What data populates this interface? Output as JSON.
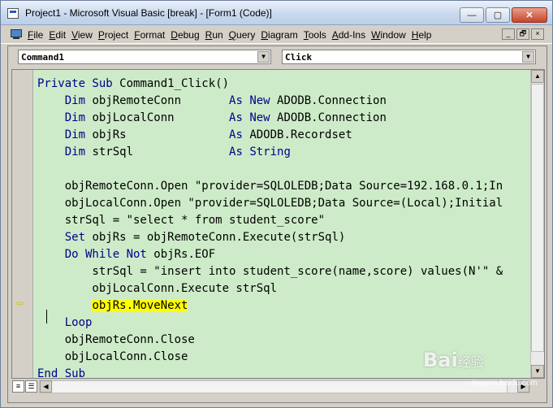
{
  "window": {
    "title": "Project1 - Microsoft Visual Basic [break] - [Form1 (Code)]",
    "controls": {
      "minimize": "—",
      "maximize": "▢",
      "close": "✕"
    }
  },
  "menubar": {
    "items": [
      "File",
      "Edit",
      "View",
      "Project",
      "Format",
      "Debug",
      "Run",
      "Query",
      "Diagram",
      "Tools",
      "Add-Ins",
      "Window",
      "Help"
    ],
    "mdi_controls": {
      "minimize": "_",
      "restore": "🗗",
      "close": "×"
    }
  },
  "code_window": {
    "object_combo": "Command1",
    "procedure_combo": "Click",
    "lines": [
      [
        {
          "t": "Private Sub ",
          "c": "kw"
        },
        {
          "t": "Command1_Click()"
        }
      ],
      [
        {
          "t": "    "
        },
        {
          "t": "Dim",
          "c": "kw"
        },
        {
          "t": " objRemoteConn       "
        },
        {
          "t": "As New",
          "c": "kw"
        },
        {
          "t": " ADODB.Connection"
        }
      ],
      [
        {
          "t": "    "
        },
        {
          "t": "Dim",
          "c": "kw"
        },
        {
          "t": " objLocalConn        "
        },
        {
          "t": "As New",
          "c": "kw"
        },
        {
          "t": " ADODB.Connection"
        }
      ],
      [
        {
          "t": "    "
        },
        {
          "t": "Dim",
          "c": "kw"
        },
        {
          "t": " objRs               "
        },
        {
          "t": "As",
          "c": "kw"
        },
        {
          "t": " ADODB.Recordset"
        }
      ],
      [
        {
          "t": "    "
        },
        {
          "t": "Dim",
          "c": "kw"
        },
        {
          "t": " strSql              "
        },
        {
          "t": "As String",
          "c": "kw"
        }
      ],
      [
        {
          "t": ""
        }
      ],
      [
        {
          "t": "    objRemoteConn.Open \"provider=SQLOLEDB;Data Source=192.168.0.1;In"
        }
      ],
      [
        {
          "t": "    objLocalConn.Open \"provider=SQLOLEDB;Data Source=(Local);Initial"
        }
      ],
      [
        {
          "t": "    strSql = \"select * from student_score\""
        }
      ],
      [
        {
          "t": "    "
        },
        {
          "t": "Set",
          "c": "kw"
        },
        {
          "t": " objRs = objRemoteConn.Execute(strSql)"
        }
      ],
      [
        {
          "t": "    "
        },
        {
          "t": "Do While Not",
          "c": "kw"
        },
        {
          "t": " objRs.EOF"
        }
      ],
      [
        {
          "t": "        strSql = \"insert into student_score(name,score) values(N'\" &"
        }
      ],
      [
        {
          "t": "        objLocalConn.Execute strSql"
        }
      ],
      [
        {
          "t": "        "
        },
        {
          "t": "objRs.MoveNext",
          "c": "hl"
        }
      ],
      [
        {
          "t": "    "
        },
        {
          "t": "Loop",
          "c": "kw"
        }
      ],
      [
        {
          "t": "    objRemoteConn.Close"
        }
      ],
      [
        {
          "t": "    objLocalConn.Close"
        }
      ],
      [
        {
          "t": "End Sub",
          "c": "kw"
        }
      ]
    ],
    "execution_marker": "⇨"
  },
  "watermark": {
    "brand": "Bai",
    "suffix": "经验",
    "sub": "jingyan.baidu.com"
  }
}
